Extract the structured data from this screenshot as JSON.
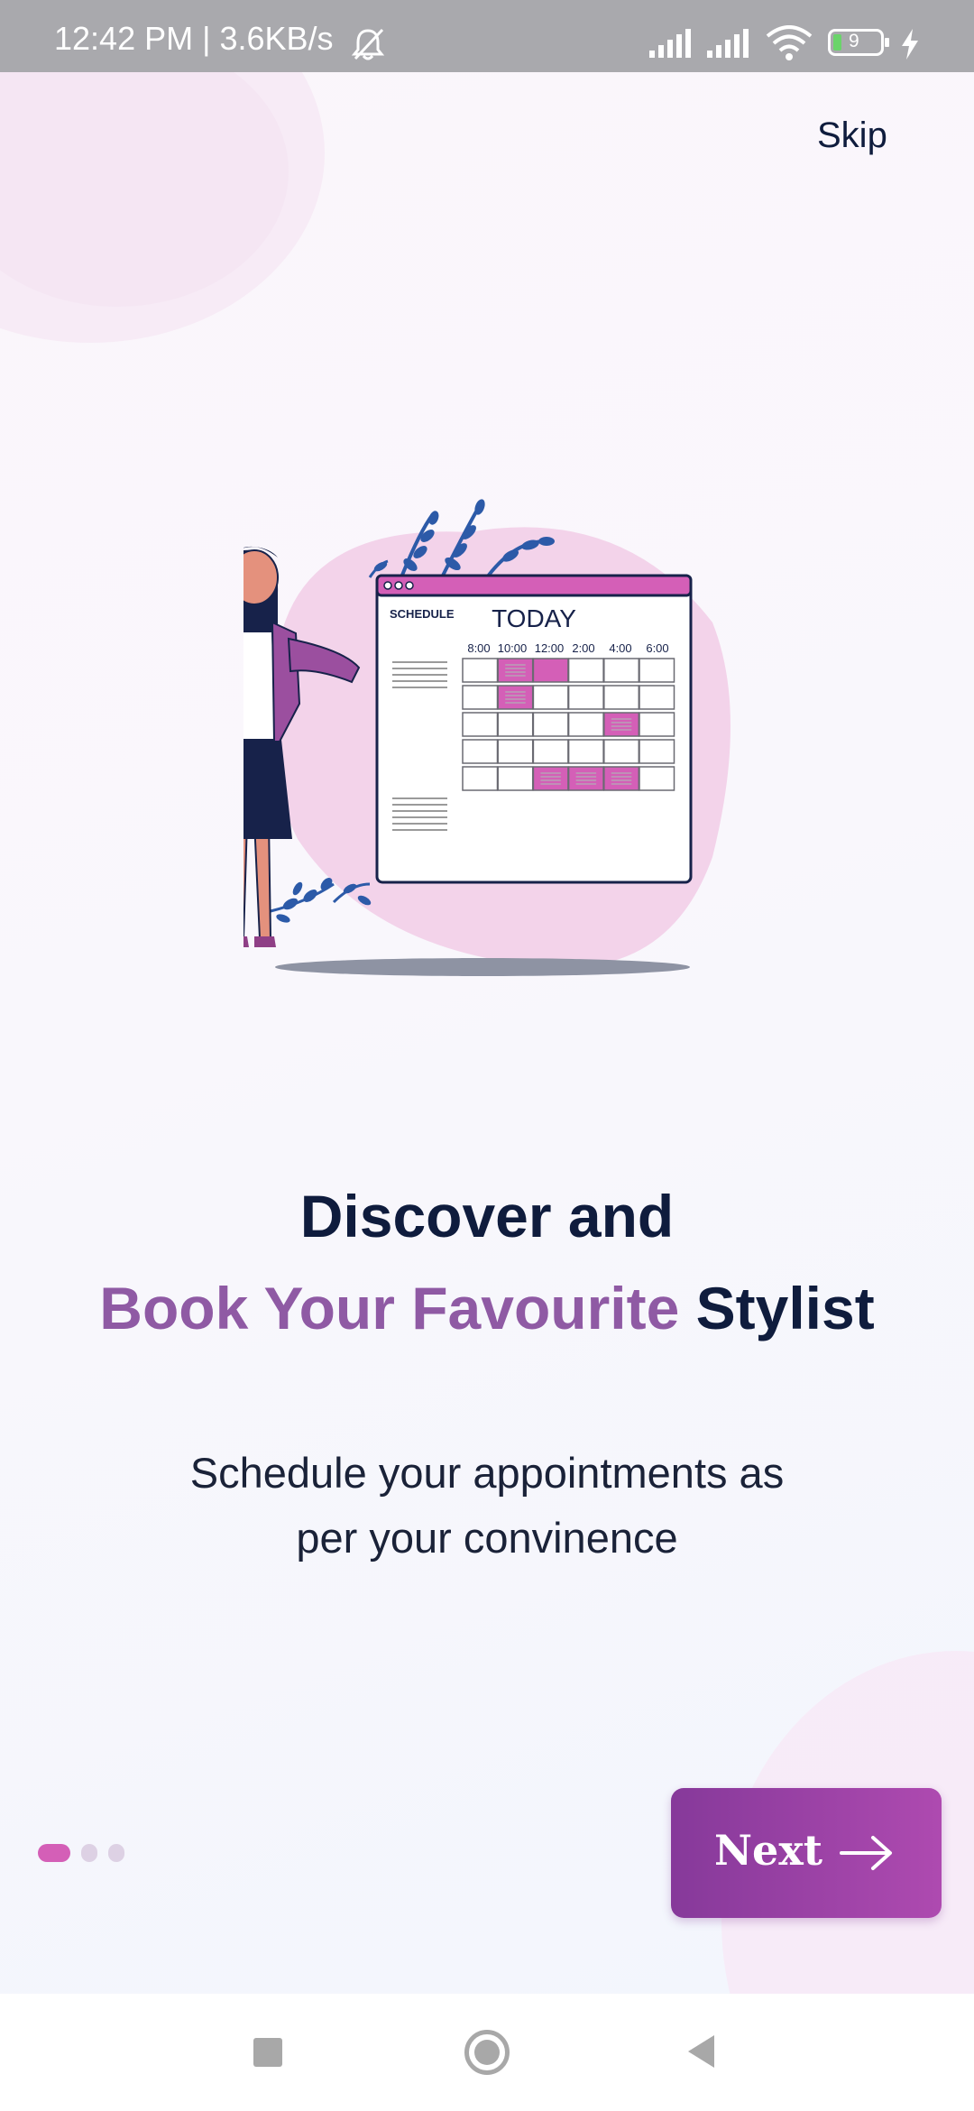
{
  "status_bar": {
    "time_speed": "12:42 PM | 3.6KB/s",
    "battery_level": "9",
    "icons": [
      "bell-off-icon",
      "signal-icon",
      "signal-icon",
      "wifi-icon",
      "battery-icon",
      "charging-icon"
    ]
  },
  "top_bar": {
    "skip_label": "Skip"
  },
  "illustration": {
    "window_title": "TODAY",
    "window_caption": "SCHEDULE",
    "times": [
      "8:00",
      "10:00",
      "12:00",
      "2:00",
      "4:00",
      "6:00"
    ]
  },
  "headline": {
    "line1": "Discover and",
    "line2_accent": "Book Your Favourite",
    "line2_rest": "Stylist"
  },
  "subtitle": {
    "line1": "Schedule your appointments as",
    "line2": "per your convinence"
  },
  "pager": {
    "count": 3,
    "active_index": 0
  },
  "next_button": {
    "label": "Next"
  },
  "nav_bar": {
    "icons": [
      "recents-icon",
      "home-icon",
      "back-icon"
    ]
  },
  "colors": {
    "accent_purple": "#8f5aa4",
    "heading_navy": "#0f1c3d",
    "pink": "#d45fb7",
    "button_start": "#86399a",
    "button_end": "#ae4ab0"
  }
}
